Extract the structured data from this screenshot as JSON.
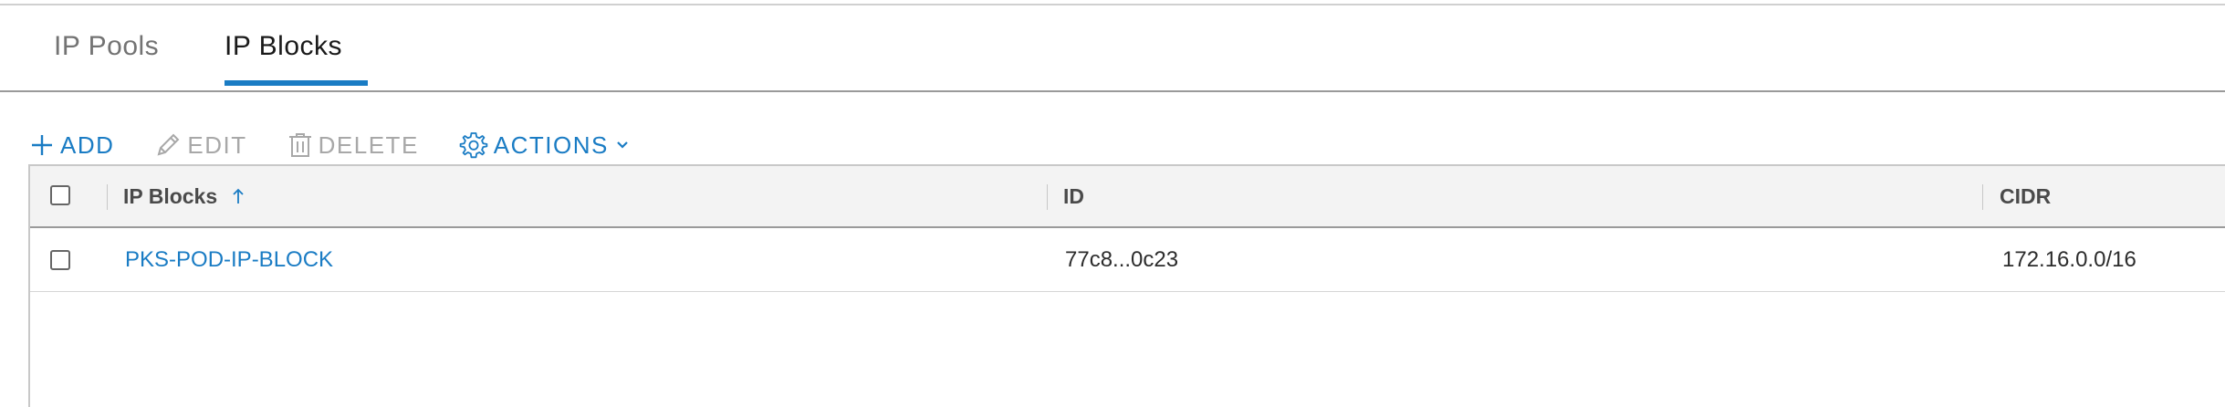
{
  "tabs": [
    {
      "label": "IP Pools",
      "active": false
    },
    {
      "label": "IP Blocks",
      "active": true
    }
  ],
  "toolbar": {
    "add_label": "ADD",
    "edit_label": "EDIT",
    "delete_label": "DELETE",
    "actions_label": "ACTIONS"
  },
  "grid": {
    "columns": [
      {
        "label": "IP Blocks",
        "sort": "ascending"
      },
      {
        "label": "ID"
      },
      {
        "label": "CIDR"
      }
    ],
    "rows": [
      {
        "name": "PKS-POD-IP-BLOCK",
        "id": "77c8...0c23",
        "cidr": "172.16.0.0/16",
        "selected": false
      }
    ]
  },
  "colors": {
    "accent": "#1a7cc4",
    "disabled": "#a8a8a8",
    "header_bg": "#f3f3f3"
  },
  "icons": {
    "add": "plus-icon",
    "edit": "pencil-icon",
    "delete": "trash-icon",
    "actions": "gear-icon",
    "actions_menu": "chevron-down-icon",
    "sort": "arrow-up-icon"
  }
}
